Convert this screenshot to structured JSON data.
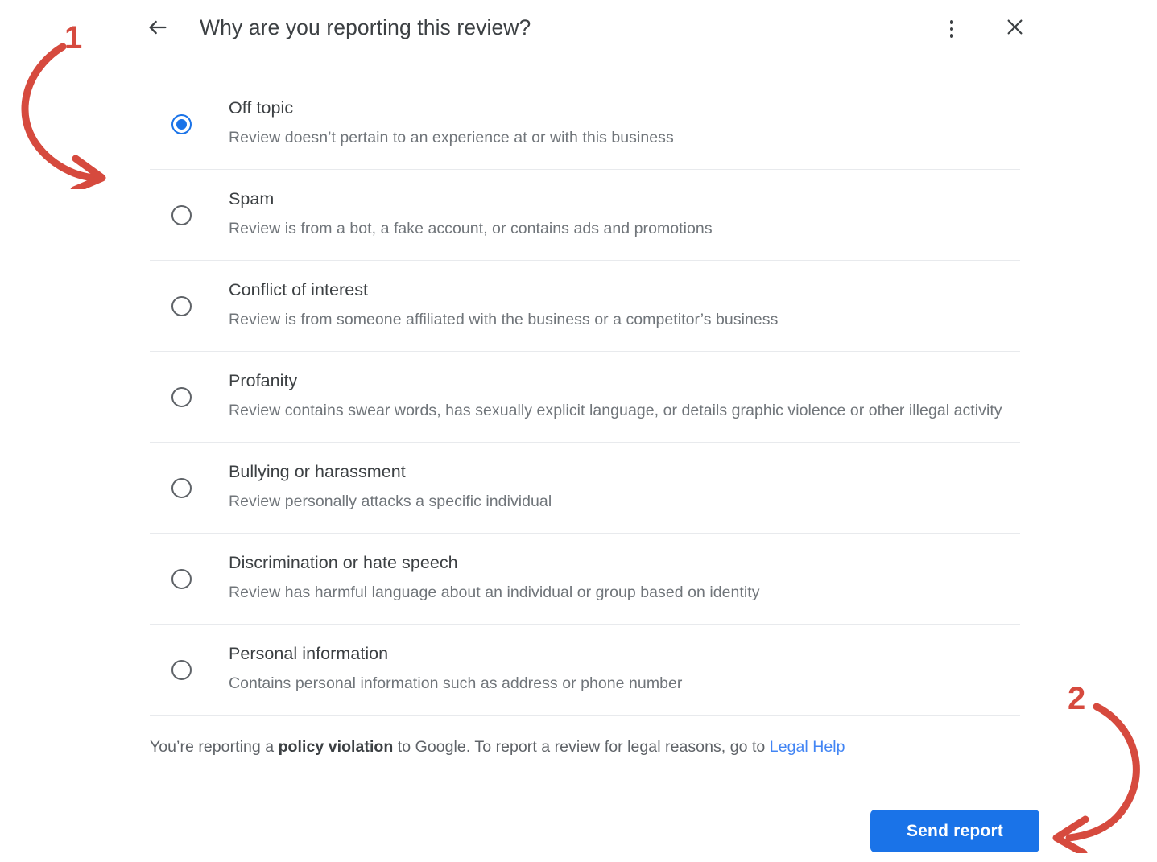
{
  "header": {
    "title": "Why are you reporting this review?",
    "back_icon": "arrow-left-icon",
    "overflow_icon": "more-vertical-icon",
    "close_icon": "close-icon"
  },
  "options": [
    {
      "label": "Off topic",
      "description": "Review doesn’t pertain to an experience at or with this business",
      "selected": true
    },
    {
      "label": "Spam",
      "description": "Review is from a bot, a fake account, or contains ads and promotions",
      "selected": false
    },
    {
      "label": "Conflict of interest",
      "description": "Review is from someone affiliated with the business or a competitor’s business",
      "selected": false
    },
    {
      "label": "Profanity",
      "description": "Review contains swear words, has sexually explicit language, or details graphic violence or other illegal activity",
      "selected": false
    },
    {
      "label": "Bullying or harassment",
      "description": "Review personally attacks a specific individual",
      "selected": false
    },
    {
      "label": "Discrimination or hate speech",
      "description": "Review has harmful language about an individual or group based on identity",
      "selected": false
    },
    {
      "label": "Personal information",
      "description": "Contains personal information such as address or phone number",
      "selected": false
    }
  ],
  "disclaimer": {
    "prefix": "You’re reporting a ",
    "bold": "policy violation",
    "middle": " to Google. To report a review for legal reasons, go to ",
    "link": "Legal Help"
  },
  "footer": {
    "send_report_label": "Send report"
  },
  "annotations": [
    {
      "number": "1"
    },
    {
      "number": "2"
    }
  ],
  "colors": {
    "accent_blue": "#1a73e8",
    "link_blue": "#4285f4",
    "annotation_red": "#d64a3e",
    "text_primary": "#3c4043",
    "text_secondary": "#70757a",
    "divider": "#e8eaed"
  }
}
